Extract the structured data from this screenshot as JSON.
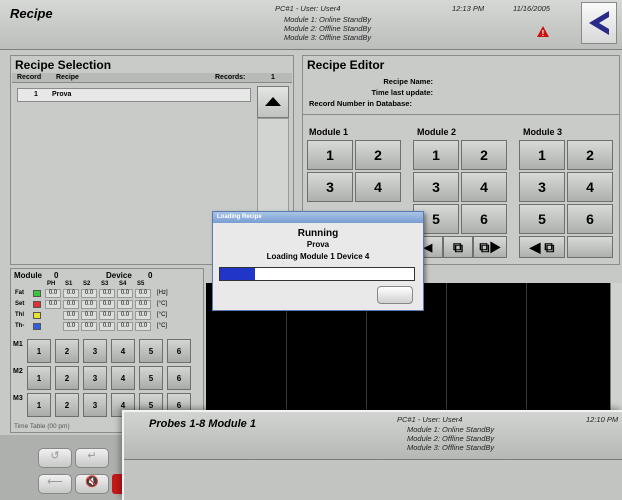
{
  "header": {
    "title": "Recipe",
    "pc_user": "PC#1 - User: User4",
    "modules": [
      "Module 1: Online StandBy",
      "Module 2: Offline StandBy",
      "Module 3: Offline StandBy"
    ],
    "time": "12:13 PM",
    "date": "11/16/2005"
  },
  "recipe_selection": {
    "title": "Recipe Selection",
    "col_record": "Record",
    "col_recipe": "Recipe",
    "records_label": "Records:",
    "records_count": "1",
    "row": {
      "record": "1",
      "recipe": "Prova"
    }
  },
  "recipe_editor": {
    "title": "Recipe Editor",
    "recipe_name_label": "Recipe Name:",
    "time_last_update_label": "Time last update:",
    "record_number_label": "Record Number in Database:",
    "module_labels": [
      "Module 1",
      "Module 2",
      "Module 3"
    ],
    "buttons": [
      "1",
      "2",
      "3",
      "4",
      "5",
      "6"
    ]
  },
  "loading_dialog": {
    "title": "Loading Recipe",
    "status": "Running",
    "recipe": "Prova",
    "message": "Loading Module 1 Device 4",
    "progress": 0.18
  },
  "module_panel": {
    "module_label": "Module",
    "module_value": "0",
    "device_label": "Device",
    "device_value": "0",
    "headers": [
      "PH",
      "S1",
      "S2",
      "S3",
      "S4",
      "S5"
    ],
    "rows": [
      {
        "label": "Fat",
        "values": [
          "0.0",
          "0.0",
          "0.0",
          "0.0",
          "0.0",
          "0.0"
        ],
        "unit": "[Hz]"
      },
      {
        "label": "Set",
        "values": [
          "0.0",
          "0.0",
          "0.0",
          "0.0",
          "0.0",
          "0.0"
        ],
        "unit": "[°C]"
      },
      {
        "label": "Thl",
        "values": [
          "",
          "0.0",
          "0.0",
          "0.0",
          "0.0",
          "0.0"
        ],
        "unit": "[°C]"
      },
      {
        "label": "Th-",
        "values": [
          "",
          "0.0",
          "0.0",
          "0.0",
          "0.0",
          "0.0"
        ],
        "unit": "[°C]"
      }
    ],
    "m_labels": [
      "M1",
      "M2",
      "M3"
    ],
    "m_buttons": [
      "1",
      "2",
      "3",
      "4",
      "5",
      "6"
    ],
    "time_table": "Time Table (00 pm)"
  },
  "overlay": {
    "title": "Probes 1-8 Module 1",
    "pc_user": "PC#1 - User: User4",
    "modules": [
      "Module 1: Online StandBy",
      "Module 2: Offline StandBy",
      "Module 3: Offline StandBy"
    ],
    "time": "12:10 PM"
  },
  "colors": {
    "progress": "#1f36c8",
    "warning": "#cc1111",
    "nav": "#2a2a8a"
  }
}
